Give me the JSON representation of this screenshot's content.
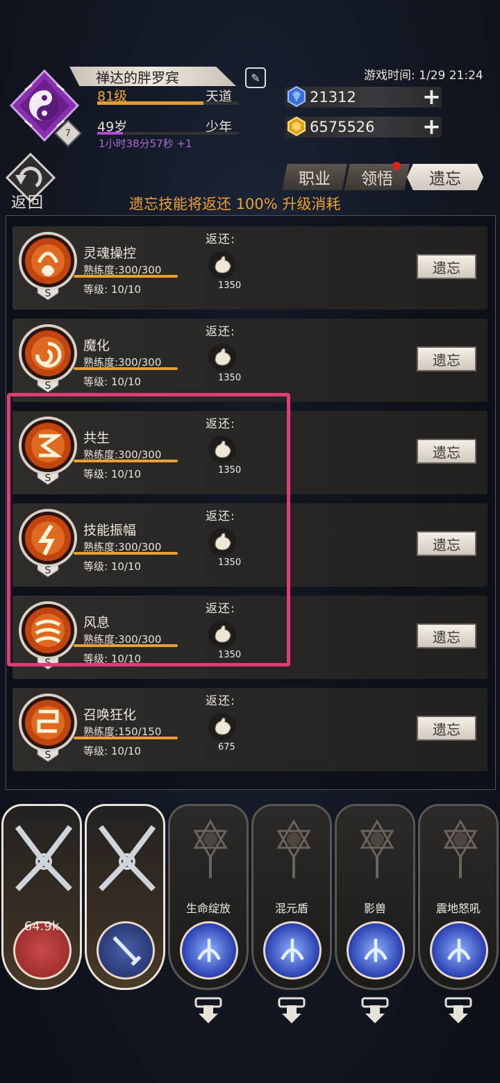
{
  "player": {
    "name": "禅达的胖罗宾",
    "level": "81级",
    "realm": "天道",
    "level_progress": 0.75,
    "age": "49岁",
    "life_stage": "少年",
    "age_progress": 0.18,
    "age_timer": "1小时38分57秒 +1",
    "rank_badge": "7"
  },
  "game_time": "游戏时间: 1/29 21:24",
  "currency": {
    "gem": "21312",
    "gold": "6575526"
  },
  "back_label": "返回",
  "tabs": [
    {
      "label": "职业"
    },
    {
      "label": "领悟"
    },
    {
      "label": "遗忘"
    }
  ],
  "notice": "遗忘技能将返还 100% 升级消耗",
  "return_label": "返还:",
  "forget_label": "遗忘",
  "grade_label": "S",
  "skills": [
    {
      "name": "灵魂操控",
      "proficiency": "熟练度:300/300",
      "level": "等级: 10/10",
      "return_value": "1350"
    },
    {
      "name": "魔化",
      "proficiency": "熟练度:300/300",
      "level": "等级: 10/10",
      "return_value": "1350"
    },
    {
      "name": "共生",
      "proficiency": "熟练度:300/300",
      "level": "等级: 10/10",
      "return_value": "1350"
    },
    {
      "name": "技能振幅",
      "proficiency": "熟练度:300/300",
      "level": "等级: 10/10",
      "return_value": "1350"
    },
    {
      "name": "风息",
      "proficiency": "熟练度:300/300",
      "level": "等级: 10/10",
      "return_value": "1350"
    },
    {
      "name": "召唤狂化",
      "proficiency": "熟练度:150/150",
      "level": "等级: 10/10",
      "return_value": "675"
    }
  ],
  "bottom_slots": [
    {
      "name": "",
      "orb": "64.9k"
    },
    {
      "name": "",
      "orb": ""
    },
    {
      "name": "生命绽放"
    },
    {
      "name": "混元盾"
    },
    {
      "name": "影兽"
    },
    {
      "name": "震地怒吼"
    }
  ],
  "colors": {
    "accent_orange": "#eea033",
    "highlight_pink": "#e23b7a",
    "age_purple": "#b24bd0"
  }
}
